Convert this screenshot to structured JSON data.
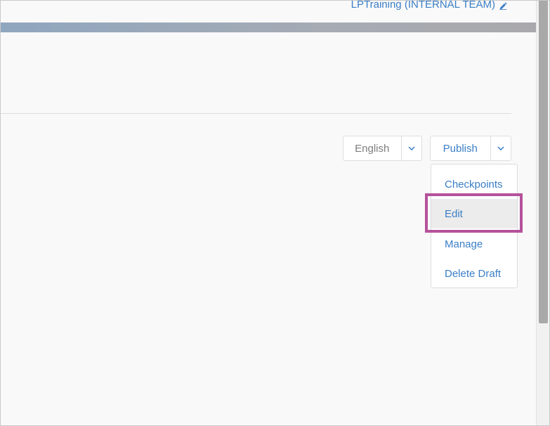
{
  "header": {
    "user_label": "LPTraining (INTERNAL TEAM)",
    "user_edit_icon": "pencil-icon"
  },
  "toolbar": {
    "language": {
      "label": "English",
      "caret_icon": "chevron-down-icon"
    },
    "publish": {
      "label": "Publish",
      "caret_icon": "chevron-down-icon"
    }
  },
  "publish_menu": {
    "items": [
      {
        "label": "Checkpoints"
      },
      {
        "label": "Edit"
      },
      {
        "label": "Manage"
      },
      {
        "label": "Delete Draft"
      }
    ],
    "highlighted_item": "Edit"
  },
  "colors": {
    "link": "#3a7ec6",
    "highlight_border": "#b5529b",
    "hover_bg": "#ececec",
    "muted_text": "#7d7d7d"
  }
}
